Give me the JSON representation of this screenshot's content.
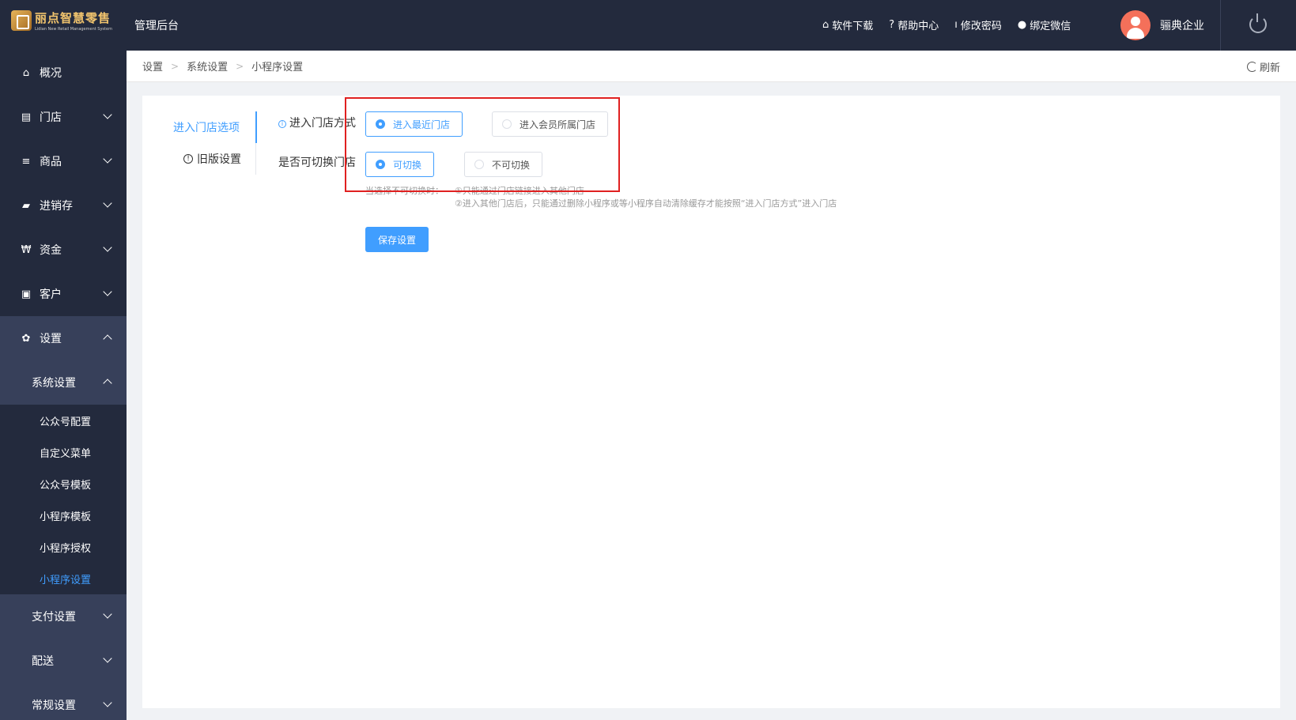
{
  "header": {
    "logo_title": "丽点智慧零售",
    "logo_subtitle": "Lidian New Retail Management System",
    "system_title": "管理后台",
    "links": [
      {
        "icon": "store-icon",
        "glyph": "⌂",
        "label": "软件下载"
      },
      {
        "icon": "help-icon",
        "glyph": "?",
        "label": "帮助中心"
      },
      {
        "icon": "thermometer-icon",
        "glyph": "ı",
        "label": "修改密码"
      },
      {
        "icon": "wechat-icon",
        "glyph": "●",
        "label": "绑定微信"
      }
    ],
    "company": "骊典企业"
  },
  "sidebar": {
    "items": [
      {
        "icon": "home-icon",
        "glyph": "⌂",
        "label": "概况"
      },
      {
        "icon": "store-icon",
        "glyph": "▤",
        "label": "门店"
      },
      {
        "icon": "list-icon",
        "glyph": "≡",
        "label": "商品"
      },
      {
        "icon": "truck-icon",
        "glyph": "▰",
        "label": "进销存"
      },
      {
        "icon": "won-icon",
        "glyph": "₩",
        "label": "资金"
      },
      {
        "icon": "idcard-icon",
        "glyph": "▣",
        "label": "客户"
      },
      {
        "icon": "gear-icon",
        "glyph": "✿",
        "label": "设置"
      }
    ],
    "system_settings": "系统设置",
    "leaves": [
      "公众号配置",
      "自定义菜单",
      "公众号模板",
      "小程序模板",
      "小程序授权",
      "小程序设置"
    ],
    "after": [
      "支付设置",
      "配送",
      "常规设置"
    ]
  },
  "breadcrumb": [
    "设置",
    "系统设置",
    "小程序设置"
  ],
  "refresh_label": "刷新",
  "tabs": [
    "进入门店选项",
    "旧版设置"
  ],
  "form": {
    "entry_mode_label": "进入门店方式",
    "entry_options": [
      "进入最近门店",
      "进入会员所属门店"
    ],
    "entry_selected": 0,
    "switch_label": "是否可切换门店",
    "switch_options": [
      "可切换",
      "不可切换"
    ],
    "switch_selected": 0,
    "hint_prefix": "当选择不可切换时：",
    "hint_line1": "①只能通过门店链接进入其他门店",
    "hint_line2": "②进入其他门店后，只能通过删除小程序或等小程序自动清除缓存才能按照“进入门店方式”进入门店",
    "save_label": "保存设置"
  }
}
